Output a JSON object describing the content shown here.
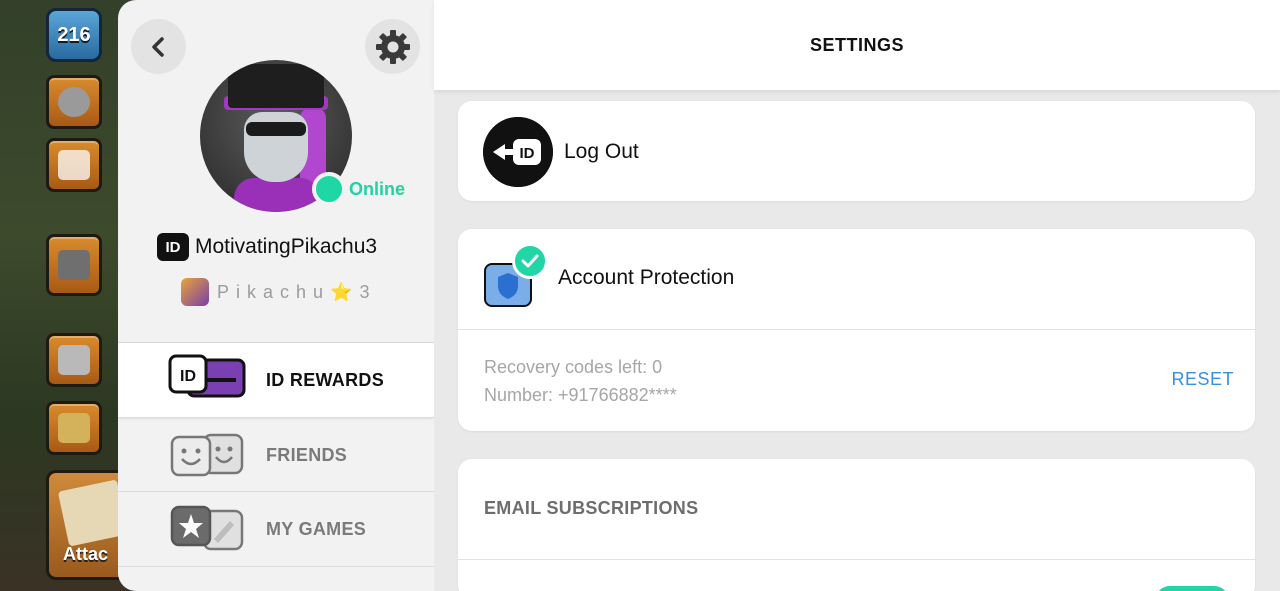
{
  "game": {
    "level": "216",
    "attack_label": "Attac"
  },
  "profile": {
    "status": "Online",
    "id_badge": "ID",
    "username": "MotivatingPikachu3",
    "ingame_name": "Pikachu⭐3"
  },
  "nav": {
    "items": [
      {
        "label": "ID REWARDS",
        "active": true
      },
      {
        "label": "FRIENDS",
        "active": false
      },
      {
        "label": "MY GAMES",
        "active": false
      }
    ]
  },
  "header": {
    "title": "SETTINGS"
  },
  "logout": {
    "label": "Log Out",
    "icon_text": "ID"
  },
  "account_protection": {
    "title": "Account Protection",
    "recovery_codes": "Recovery codes left: 0",
    "number": "Number: +91766882****",
    "reset_label": "RESET"
  },
  "email": {
    "title": "EMAIL SUBSCRIPTIONS"
  },
  "colors": {
    "accent_green": "#22d5a4",
    "link_blue": "#3a8ee0",
    "purple": "#a437c4"
  }
}
